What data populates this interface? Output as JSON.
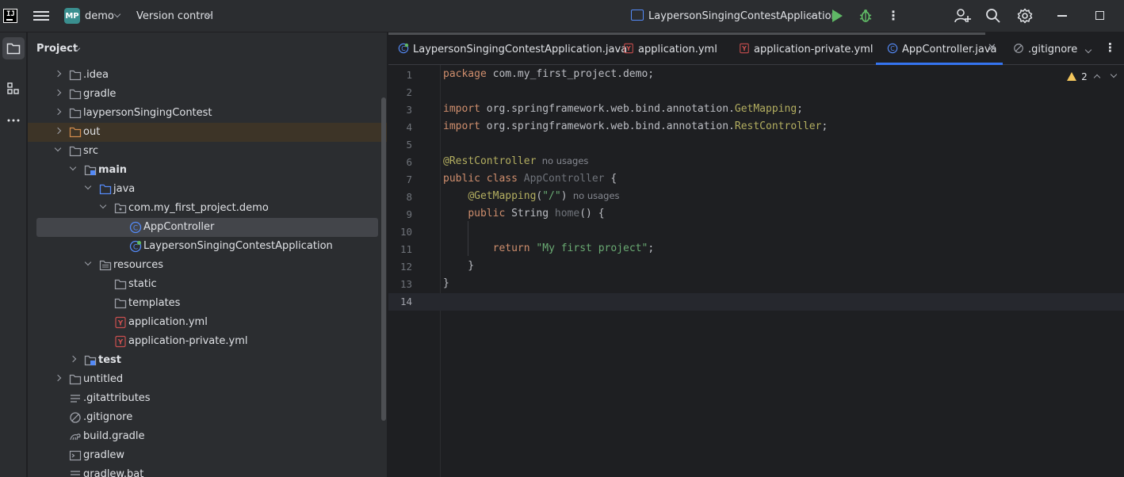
{
  "titlebar": {
    "project_badge": "MP",
    "project_name": "demo",
    "vcs_label": "Version control",
    "run_config": "LaypersonSingingContestApplication"
  },
  "project_panel": {
    "title": "Project",
    "tree": [
      {
        "label": ".idea",
        "depth": 0,
        "kind": "folder",
        "expand": "collapsed"
      },
      {
        "label": "gradle",
        "depth": 0,
        "kind": "folder",
        "expand": "collapsed"
      },
      {
        "label": "laypersonSingingContest",
        "depth": 0,
        "kind": "folder",
        "expand": "collapsed"
      },
      {
        "label": "out",
        "depth": 0,
        "kind": "folder-excluded",
        "expand": "collapsed"
      },
      {
        "label": "src",
        "depth": 0,
        "kind": "folder",
        "expand": "expanded"
      },
      {
        "label": "main",
        "depth": 1,
        "kind": "module-folder",
        "expand": "expanded",
        "bold": true
      },
      {
        "label": "java",
        "depth": 2,
        "kind": "source-folder",
        "expand": "expanded"
      },
      {
        "label": "com.my_first_project.demo",
        "depth": 3,
        "kind": "package",
        "expand": "expanded"
      },
      {
        "label": "AppController",
        "depth": 4,
        "kind": "class",
        "expand": "none",
        "selected": true
      },
      {
        "label": "LaypersonSingingContestApplication",
        "depth": 4,
        "kind": "spring-class",
        "expand": "none"
      },
      {
        "label": "resources",
        "depth": 2,
        "kind": "resources-folder",
        "expand": "expanded"
      },
      {
        "label": "static",
        "depth": 3,
        "kind": "folder",
        "expand": "none"
      },
      {
        "label": "templates",
        "depth": 3,
        "kind": "folder",
        "expand": "none"
      },
      {
        "label": "application.yml",
        "depth": 3,
        "kind": "yml",
        "expand": "none"
      },
      {
        "label": "application-private.yml",
        "depth": 3,
        "kind": "yml",
        "expand": "none"
      },
      {
        "label": "test",
        "depth": 1,
        "kind": "module-folder",
        "expand": "collapsed",
        "bold": true
      },
      {
        "label": "untitled",
        "depth": 0,
        "kind": "folder",
        "expand": "collapsed"
      },
      {
        "label": ".gitattributes",
        "depth": 0,
        "kind": "text",
        "expand": "none"
      },
      {
        "label": ".gitignore",
        "depth": 0,
        "kind": "ignore",
        "expand": "none"
      },
      {
        "label": "build.gradle",
        "depth": 0,
        "kind": "gradle",
        "expand": "none"
      },
      {
        "label": "gradlew",
        "depth": 0,
        "kind": "terminal",
        "expand": "none"
      },
      {
        "label": "gradlew.bat",
        "depth": 0,
        "kind": "text",
        "expand": "none"
      }
    ]
  },
  "tabs": [
    {
      "label": "LaypersonSingingContestApplication.java",
      "icon": "spring-class-icon"
    },
    {
      "label": "application.yml",
      "icon": "yml-icon"
    },
    {
      "label": "application-private.yml",
      "icon": "yml-icon"
    },
    {
      "label": "AppController.java",
      "icon": "class-icon",
      "active": true
    },
    {
      "label": ".gitignore",
      "icon": "ignore-icon"
    }
  ],
  "editor": {
    "warnings": "2",
    "line_numbers": [
      "1",
      "2",
      "3",
      "4",
      "5",
      "6",
      "7",
      "8",
      "9",
      "10",
      "11",
      "12",
      "13",
      "14"
    ],
    "current_line": 14,
    "lines": [
      [
        {
          "t": "package ",
          "c": "kw"
        },
        {
          "t": "com.my_first_project.demo;",
          "c": ""
        }
      ],
      [],
      [
        {
          "t": "import ",
          "c": "kw"
        },
        {
          "t": "org.springframework.web.bind.annotation.",
          "c": ""
        },
        {
          "t": "GetMapping",
          "c": "ann"
        },
        {
          "t": ";",
          "c": ""
        }
      ],
      [
        {
          "t": "import ",
          "c": "kw"
        },
        {
          "t": "org.springframework.web.bind.annotation.",
          "c": ""
        },
        {
          "t": "RestController",
          "c": "ann"
        },
        {
          "t": ";",
          "c": ""
        }
      ],
      [],
      [
        {
          "t": "@RestController",
          "c": "ann"
        },
        {
          "t": "  no usages",
          "c": "hint"
        }
      ],
      [
        {
          "t": "public class ",
          "c": "kw"
        },
        {
          "t": "AppController",
          "c": "gray"
        },
        {
          "t": " {",
          "c": ""
        }
      ],
      [
        {
          "t": "    ",
          "c": ""
        },
        {
          "t": "@GetMapping",
          "c": "ann"
        },
        {
          "t": "(",
          "c": ""
        },
        {
          "t": "\"/\"",
          "c": "str"
        },
        {
          "t": ")",
          "c": ""
        },
        {
          "t": "  no usages",
          "c": "hint"
        }
      ],
      [
        {
          "t": "    ",
          "c": ""
        },
        {
          "t": "public ",
          "c": "kw"
        },
        {
          "t": "String ",
          "c": ""
        },
        {
          "t": "home",
          "c": "gray"
        },
        {
          "t": "() {",
          "c": ""
        }
      ],
      [],
      [
        {
          "t": "        ",
          "c": ""
        },
        {
          "t": "return ",
          "c": "kw"
        },
        {
          "t": "\"My first project\"",
          "c": "str"
        },
        {
          "t": ";",
          "c": ""
        }
      ],
      [
        {
          "t": "    }",
          "c": ""
        }
      ],
      [
        {
          "t": "}",
          "c": ""
        }
      ],
      []
    ]
  },
  "colors": {
    "accent": "#3574f0",
    "keyword": "#cf8e6d",
    "annotation": "#b3ae60",
    "string": "#6aab73",
    "run_green": "#5fb865"
  }
}
